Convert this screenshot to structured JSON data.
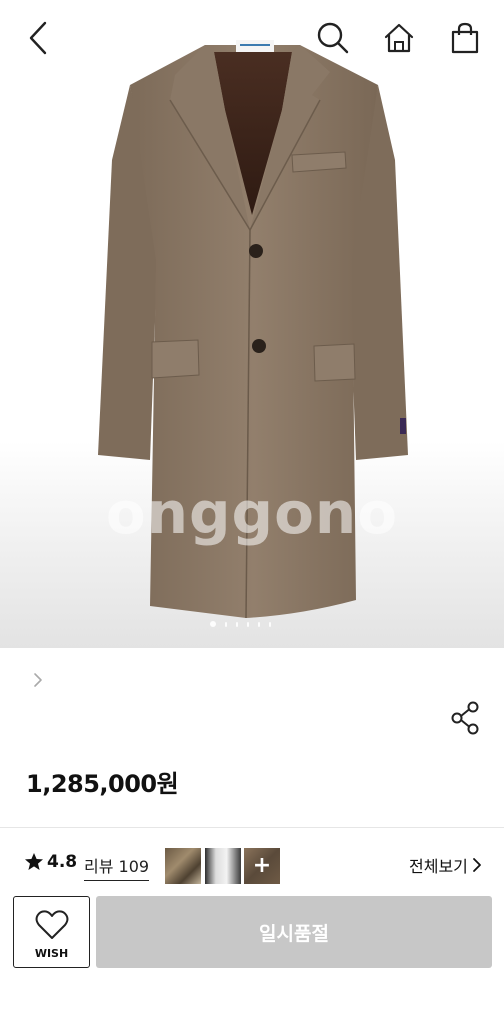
{
  "hero": {
    "watermark": "onggono",
    "slides_total": 6,
    "slide_active": 1
  },
  "nav": {
    "back_icon": "chevron-left-icon",
    "search_icon": "search-icon",
    "home_icon": "home-icon",
    "cart_icon": "shopping-bag-icon"
  },
  "product": {
    "price": "1,285,000원"
  },
  "reviews": {
    "star_icon": "star-icon",
    "rating": "4.8",
    "review_link": "리뷰 109",
    "thumb_more": "+",
    "view_all": "전체보기"
  },
  "actions": {
    "wish_label": "WISH",
    "soldout_label": "일시품절"
  },
  "colors": {
    "coat": "#8c7a68",
    "soldout_bg": "#c7c7c7",
    "text": "#111111"
  }
}
